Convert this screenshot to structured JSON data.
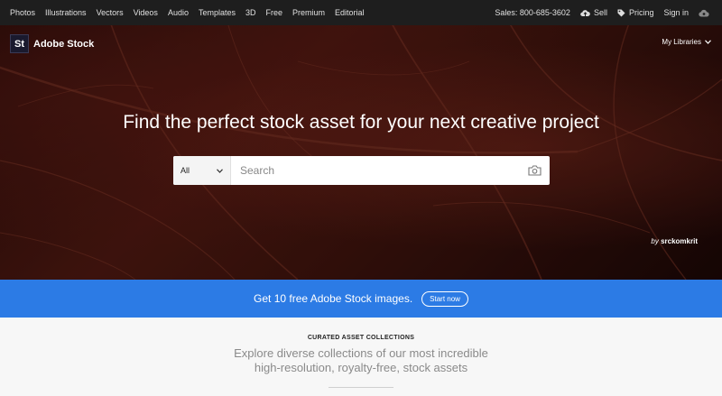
{
  "topnav": {
    "links": [
      "Photos",
      "Illustrations",
      "Vectors",
      "Videos",
      "Audio",
      "Templates",
      "3D",
      "Free",
      "Premium",
      "Editorial"
    ],
    "sales": "Sales: 800-685-3602",
    "sell": "Sell",
    "pricing": "Pricing",
    "signin": "Sign in"
  },
  "brand": {
    "logo": "St",
    "name": "Adobe Stock"
  },
  "my_libraries": "My Libraries",
  "hero": {
    "headline": "Find the perfect stock asset for your next creative project",
    "credit_prefix": "by",
    "credit_name": "srckomkrit"
  },
  "search": {
    "scope": "All",
    "placeholder": "Search"
  },
  "promo": {
    "text": "Get 10 free Adobe Stock images.",
    "button": "Start now"
  },
  "curated": {
    "kicker": "CURATED ASSET COLLECTIONS",
    "line1": "Explore diverse collections of our most incredible",
    "line2": "high-resolution, royalty-free, stock assets"
  },
  "colors": {
    "promo_bg": "#2c7be5",
    "topnav_bg": "#1e1e1e"
  }
}
